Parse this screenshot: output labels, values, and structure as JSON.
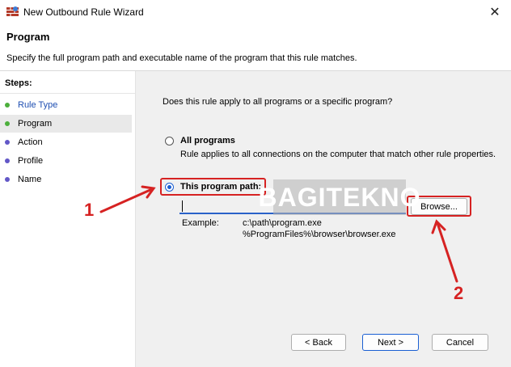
{
  "window": {
    "title": "New Outbound Rule Wizard",
    "close_glyph": "✕"
  },
  "header": {
    "title": "Program",
    "subtitle": "Specify the full program path and executable name of the program that this rule matches."
  },
  "steps": {
    "label": "Steps:",
    "items": [
      {
        "label": "Rule Type",
        "state": "done"
      },
      {
        "label": "Program",
        "state": "active"
      },
      {
        "label": "Action",
        "state": "pending"
      },
      {
        "label": "Profile",
        "state": "pending"
      },
      {
        "label": "Name",
        "state": "pending"
      }
    ]
  },
  "content": {
    "question": "Does this rule apply to all programs or a specific program?",
    "all_programs": {
      "label": "All programs",
      "description": "Rule applies to all connections on the computer that match other rule properties.",
      "checked": false
    },
    "this_program": {
      "label": "This program path:",
      "checked": true
    },
    "path_value": "",
    "browse_label": "Browse...",
    "example_label": "Example:",
    "example_1": "c:\\path\\program.exe",
    "example_2": "%ProgramFiles%\\browser\\browser.exe"
  },
  "footer": {
    "back_label": "< Back",
    "next_label": "Next >",
    "cancel_label": "Cancel"
  },
  "watermark": "BAGITEKNO",
  "annotations": {
    "one": "1",
    "two": "2"
  },
  "colors": {
    "accent": "#1a5fd3",
    "annotation": "#d62222"
  }
}
